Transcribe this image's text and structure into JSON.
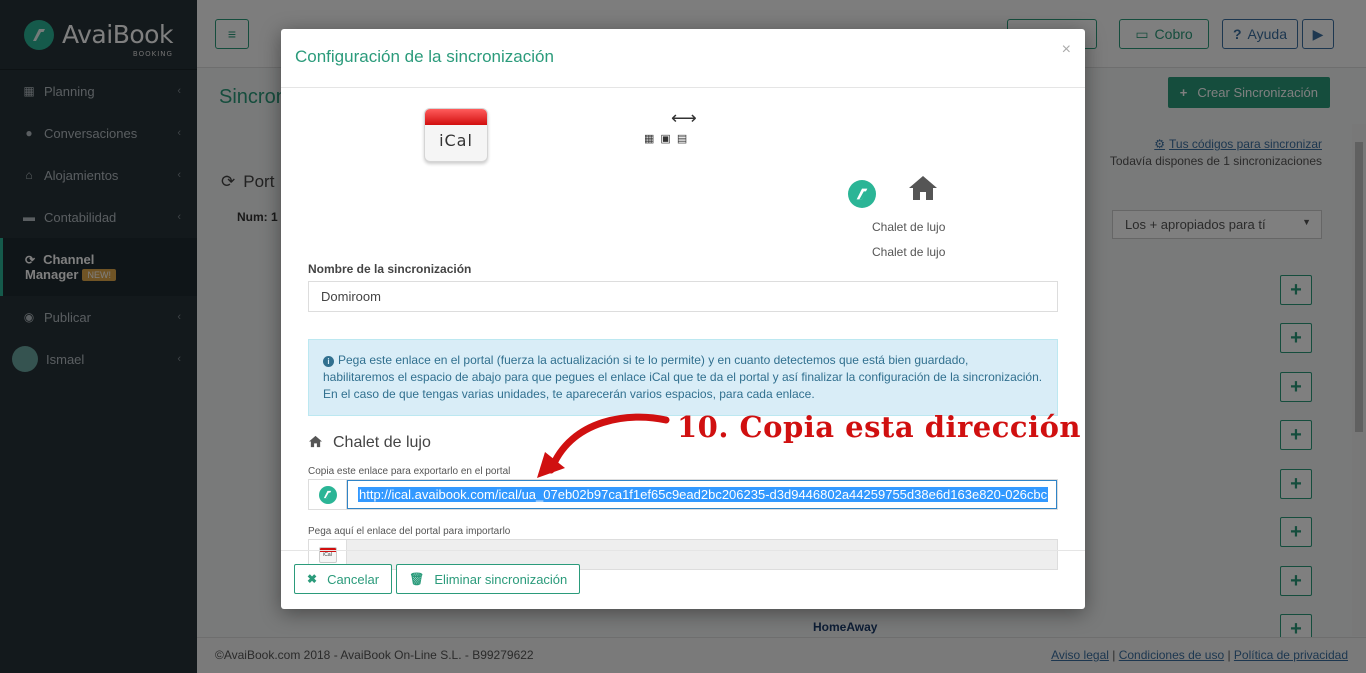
{
  "brand": {
    "name": "AvaiBook",
    "sub": "BOOKING",
    "accent": "#2bb596"
  },
  "sidebar": {
    "items": [
      {
        "label": "Planning",
        "icon": "calendar-icon"
      },
      {
        "label": "Conversaciones",
        "icon": "chat-icon"
      },
      {
        "label": "Alojamientos",
        "icon": "home-icon"
      },
      {
        "label": "Contabilidad",
        "icon": "wallet-icon"
      },
      {
        "label": "Channel",
        "label2": "Manager",
        "badge": "NEW!",
        "icon": "sync-icon",
        "active": true
      },
      {
        "label": "Publicar",
        "icon": "globe-icon"
      },
      {
        "label": "Ismael",
        "icon": "avatar"
      }
    ]
  },
  "topbar": {
    "cobro": "Cobro",
    "ayuda": "Ayuda"
  },
  "page": {
    "title": "Sincron",
    "create_button": "Crear Sincronización",
    "codes_link": "Tus códigos para sincronizar",
    "codes_sub": "Todavía dispones de 1 sincronizaciones",
    "portal_title": "Port",
    "num_label": "Num: 1",
    "sort_select": "Los + apropiados para tí",
    "homeaway": "HomeAway"
  },
  "footer": {
    "copyright": "©AvaiBook.com 2018 - AvaiBook On-Line S.L. - B99279622",
    "links": [
      "Aviso legal",
      "Condiciones de uso",
      "Política de privacidad"
    ]
  },
  "modal": {
    "title": "Configuración de la sincronización",
    "close": "×",
    "ical_label": "iCal",
    "sync_arrow": "⟷",
    "chalet_name_1": "Chalet de lujo",
    "chalet_name_2": "Chalet de lujo",
    "name_label": "Nombre de la sincronización",
    "name_value": "Domiroom",
    "info_text": "Pega este enlace en el portal (fuerza la actualización si te lo permite) y en cuanto detectemos que está bien guardado, habilitaremos el espacio de abajo para que pegues el enlace iCal que te da el portal y así finalizar la configuración de la sincronización. En el caso de que tengas varias unidades, te aparecerán varios espacios, para cada enlace.",
    "section_title": "Chalet de lujo",
    "annotation": "10. Copia esta dirección",
    "export_label": "Copia este enlace para exportarlo en el portal",
    "export_url": "http://ical.avaibook.com/ical/ua_07eb02b97ca1f1ef65c9ead2bc206235-d3d9446802a44259755d38e6d163e820-026cbc",
    "import_label": "Pega aquí el enlace del portal para importarlo",
    "import_value": "",
    "cancel_button": "Cancelar",
    "delete_button": "Eliminar sincronización"
  }
}
